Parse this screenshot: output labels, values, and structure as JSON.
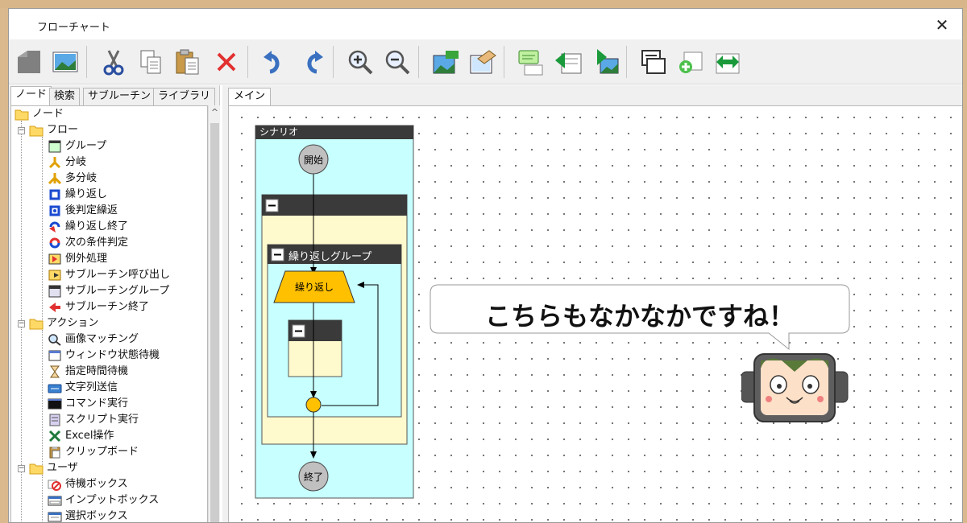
{
  "window": {
    "title": "フローチャート",
    "close_glyph": "✕"
  },
  "toolbar": {
    "buttons": [
      "node-icon",
      "image-icon",
      "cut-icon",
      "copy-icon",
      "paste-icon",
      "delete-icon",
      "undo-icon",
      "redo-icon",
      "zoom-in-icon",
      "zoom-out-icon",
      "capture-icon",
      "capture-edit-icon",
      "comment-icon",
      "image-left-icon",
      "image-right-icon",
      "window-icon",
      "add-icon",
      "resize-icon"
    ]
  },
  "left_panel": {
    "tabs": [
      "ノード",
      "検索",
      "サブルーチン",
      "ライブラリ"
    ],
    "tree": {
      "root": "ノード",
      "flow": {
        "label": "フロー",
        "items": [
          "グループ",
          "分岐",
          "多分岐",
          "繰り返し",
          "後判定繰返",
          "繰り返し終了",
          "次の条件判定",
          "例外処理",
          "サブルーチン呼び出し",
          "サブルーチングループ",
          "サブルーチン終了"
        ]
      },
      "action": {
        "label": "アクション",
        "items": [
          "画像マッチング",
          "ウィンドウ状態待機",
          "指定時間待機",
          "文字列送信",
          "コマンド実行",
          "スクリプト実行",
          "Excel操作",
          "クリップボード"
        ]
      },
      "user": {
        "label": "ユーザ",
        "items": [
          "待機ボックス",
          "インプットボックス",
          "選択ボックス"
        ]
      }
    }
  },
  "main": {
    "tab": "メイン",
    "scenario": {
      "title": "シナリオ",
      "start": "開始",
      "end": "終了",
      "group_collapse": "−",
      "loop_group_title": "繰り返しグループ",
      "loop_label": "繰り返し"
    },
    "bubble": {
      "text": "こちらもなかなかですね！"
    }
  },
  "colors": {
    "scenario_bg": "#c8ffff",
    "group_bg": "#fffacd",
    "header_dark": "#3a3a3a",
    "loop_shape": "#ffc000",
    "node_circle": "#c0c0c0",
    "mascot_face": "#fde0c8",
    "mascot_hair": "#5a7a3a"
  }
}
